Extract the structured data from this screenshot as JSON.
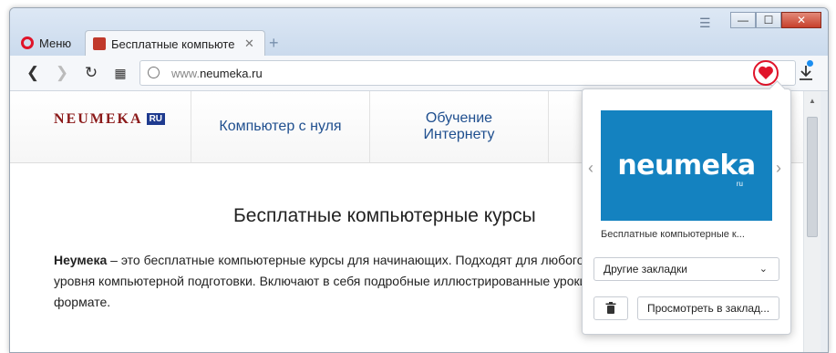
{
  "browser": {
    "menu_label": "Меню",
    "tab_title": "Бесплатные компьютерные курсы",
    "url_prefix": "www.",
    "url_domain": "neumeka.ru"
  },
  "site": {
    "logo_text": "NEUMEKA",
    "logo_badge": "RU",
    "nav": [
      "Компьютер с нуля",
      "Обучение Интернету"
    ],
    "heading": "Бесплатные компьютерные курсы",
    "intro_bold": "Неумека",
    "intro_text": " – это бесплатные компьютерные курсы для начинающих. Подходят для любого уровня компьютерной подготовки. Включают в себя подробные иллюстрированные уроки в формате."
  },
  "popup": {
    "thumb_logo": "neumeka",
    "thumb_ru": "ru",
    "thumb_title": "Бесплатные компьютерные к...",
    "folder_select": "Другие закладки",
    "view_button": "Просмотреть в заклад..."
  },
  "colors": {
    "accent_red": "#e0142a",
    "brand_blue": "#1482c0"
  }
}
